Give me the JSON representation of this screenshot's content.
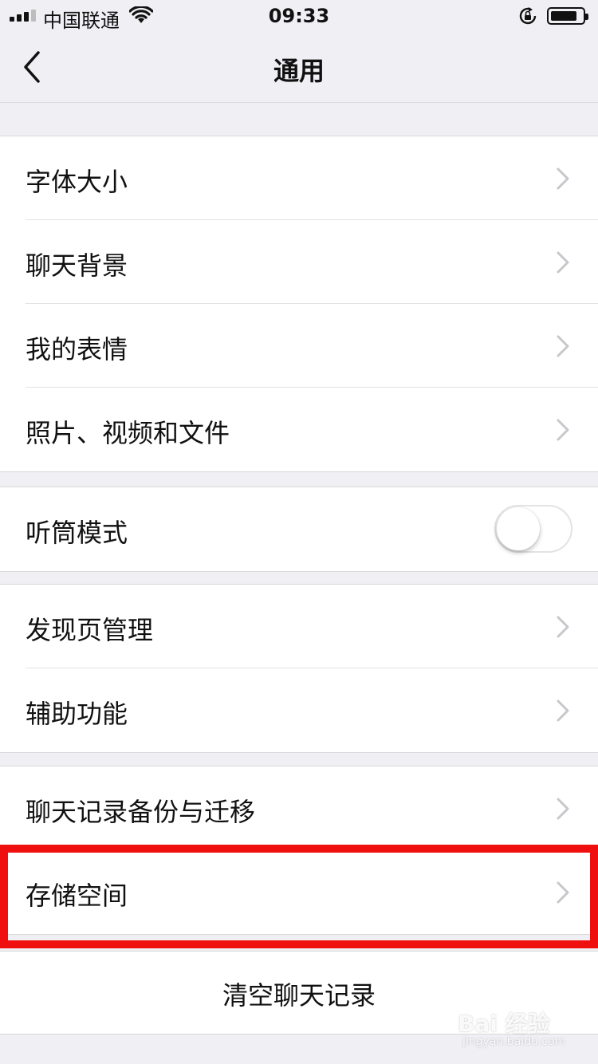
{
  "status_bar": {
    "carrier": "中国联通",
    "time": "09:33",
    "battery_level": 0.9
  },
  "nav": {
    "title": "通用",
    "back_icon": "chevron-left-icon"
  },
  "groups": [
    {
      "items": [
        {
          "label": "字体大小",
          "control": "chevron"
        },
        {
          "label": "聊天背景",
          "control": "chevron"
        },
        {
          "label": "我的表情",
          "control": "chevron"
        },
        {
          "label": "照片、视频和文件",
          "control": "chevron"
        }
      ]
    },
    {
      "items": [
        {
          "label": "听筒模式",
          "control": "toggle",
          "toggle_on": false
        }
      ]
    },
    {
      "items": [
        {
          "label": "发现页管理",
          "control": "chevron"
        },
        {
          "label": "辅助功能",
          "control": "chevron"
        }
      ]
    },
    {
      "items": [
        {
          "label": "聊天记录备份与迁移",
          "control": "chevron"
        },
        {
          "label": "存储空间",
          "control": "chevron",
          "highlighted": true
        }
      ]
    }
  ],
  "clear_history": {
    "label": "清空聊天记录"
  },
  "watermark": {
    "text": "Bai 经验",
    "sub": "jingyan.baidu.com"
  },
  "colors": {
    "background": "#efeff4",
    "highlight_border": "#f00f0f",
    "chevron": "#c7c7cc"
  }
}
